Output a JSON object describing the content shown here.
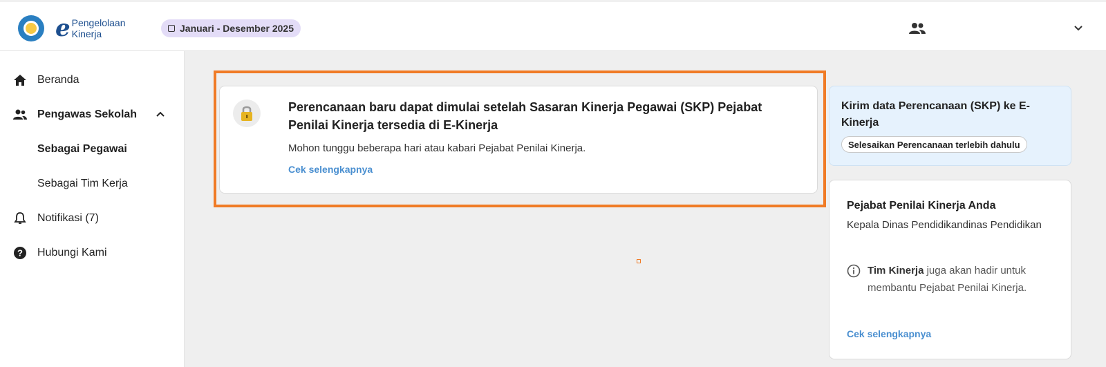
{
  "header": {
    "brand_line1": "Pengelolaan",
    "brand_line2": "Kinerja",
    "period": "Januari - Desember 2025"
  },
  "sidebar": {
    "items": [
      {
        "label": "Beranda",
        "icon": "home-icon"
      },
      {
        "label": "Pengawas Sekolah",
        "icon": "people-icon",
        "expanded": true
      },
      {
        "label": "Sebagai Pegawai",
        "active": true
      },
      {
        "label": "Sebagai Tim Kerja"
      },
      {
        "label": "Notifikasi (7)",
        "icon": "bell-icon"
      },
      {
        "label": "Hubungi Kami",
        "icon": "help-icon"
      }
    ]
  },
  "notice": {
    "title": "Perencanaan baru dapat dimulai setelah Sasaran Kinerja Pegawai (SKP) Pejabat Penilai Kinerja tersedia di E-Kinerja",
    "body": "Mohon tunggu beberapa hari atau kabari Pejabat Penilai Kinerja.",
    "link": "Cek selengkapnya"
  },
  "send_card": {
    "title": "Kirim data Perencanaan (SKP) ke E-Kinerja",
    "chip": "Selesaikan Perencanaan terlebih dahulu"
  },
  "assessor_card": {
    "title": "Pejabat Penilai Kinerja Anda",
    "name": "Kepala Dinas Pendidikandinas Pendidikan",
    "info_bold": "Tim Kinerja",
    "info_rest": " juga akan hadir untuk membantu Pejabat Penilai Kinerja.",
    "link": "Cek selengkapnya"
  },
  "colors": {
    "highlight": "#f07b26",
    "link": "#4a8fd0",
    "period_chip": "#e3dcf7",
    "send_card_bg": "#e6f2fd"
  }
}
